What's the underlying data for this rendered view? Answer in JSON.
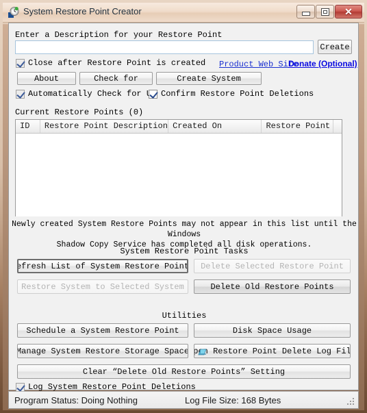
{
  "window": {
    "title": "System Restore Point Creator",
    "app_icon": "clock-icon",
    "controls": {
      "minimize": "minimize-icon",
      "maximize": "maximize-icon",
      "close": "✕"
    }
  },
  "form": {
    "description_label": "Enter a Description for your Restore Point",
    "description_value": "",
    "description_placeholder": "",
    "create_button": "Create",
    "close_after_checkbox": {
      "label": "Close after Restore Point is created",
      "checked": true
    },
    "links": {
      "product_web_site": "Product Web Site",
      "donate": "Donate (Optional)"
    }
  },
  "action_buttons": {
    "about": "About",
    "check_for": "Check for",
    "create_system": "Create System"
  },
  "option_checkboxes": {
    "auto_check_updates": {
      "label": "Automatically Check for Updat",
      "checked": true
    },
    "confirm_deletions": {
      "label": "Confirm Restore Point Deletions",
      "checked": true
    }
  },
  "restore_points": {
    "group_label": "Current Restore Points (0)",
    "columns": [
      "ID",
      "Restore Point Description",
      "Created On",
      "Restore Point Type",
      ""
    ],
    "rows": [],
    "note_line_1": "Newly created System Restore Points may not appear in this list until the Windows",
    "note_line_2": "Shadow Copy Service has completed all disk operations."
  },
  "tasks": {
    "heading": "System Restore Point Tasks",
    "refresh_list": "Refresh List of System Restore Points",
    "delete_selected": "Delete Selected Restore Point",
    "restore_system": "Restore System to Selected System",
    "delete_old": "Delete Old Restore Points"
  },
  "utilities": {
    "heading": "Utilities",
    "schedule": "Schedule a System Restore Point",
    "disk_space": "Disk Space Usage",
    "manage_storage": "Manage System Restore Storage Space",
    "open_log": "Open Restore Point Delete Log File",
    "open_log_icon": "log-file-icon",
    "clear_setting": "Clear “Delete Old Restore Points” Setting"
  },
  "log_checkbox": {
    "label": "Log System Restore Point Deletions",
    "checked": true
  },
  "statusbar": {
    "program_status_label": "Program Status:",
    "program_status_value": "Doing Nothing",
    "log_file_size_label": "Log File Size:",
    "log_file_size_value": "168 Bytes",
    "grip": "resize-grip"
  },
  "colors": {
    "frame": "#6b4a32",
    "title_bg": "#f0dcca",
    "client_bg": "#f1f1f1",
    "link": "#1a2fd0",
    "close_btn": "#b23c34"
  }
}
